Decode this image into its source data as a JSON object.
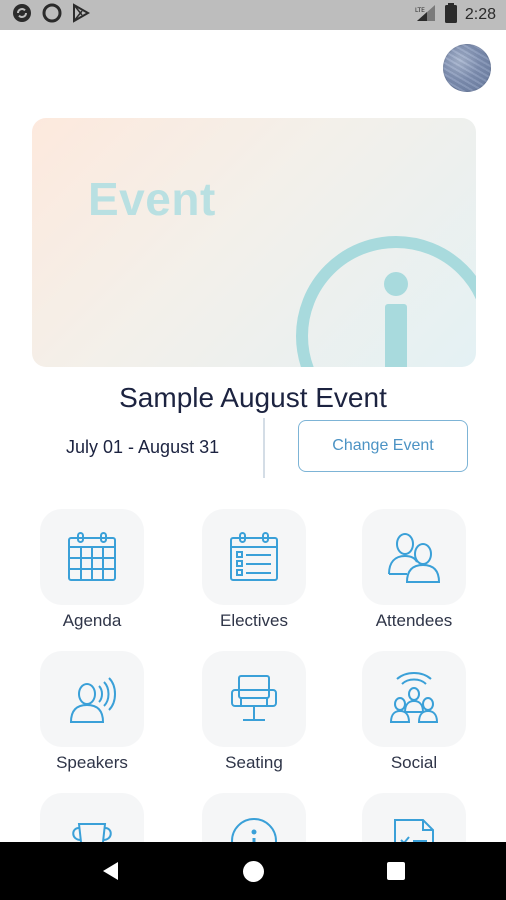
{
  "status_bar": {
    "time": "2:28",
    "icons": [
      "sync-icon",
      "circle-icon",
      "play-store-icon",
      "signal-lte-icon",
      "battery-icon"
    ]
  },
  "profile": {
    "avatar": "avatar"
  },
  "banner": {
    "word": "Event",
    "icon": "info-icon"
  },
  "event": {
    "title": "Sample August Event",
    "dates": "July 01 - August 31",
    "change_button": "Change Event"
  },
  "grid": {
    "items": [
      {
        "label": "Agenda",
        "icon": "calendar-icon"
      },
      {
        "label": "Electives",
        "icon": "checklist-calendar-icon"
      },
      {
        "label": "Attendees",
        "icon": "people-icon"
      },
      {
        "label": "Speakers",
        "icon": "speaker-icon"
      },
      {
        "label": "Seating",
        "icon": "chair-icon"
      },
      {
        "label": "Social",
        "icon": "social-broadcast-icon"
      },
      {
        "label": "",
        "icon": "trophy-icon"
      },
      {
        "label": "",
        "icon": "info-icon"
      },
      {
        "label": "",
        "icon": "survey-icon"
      }
    ]
  },
  "colors": {
    "icon_blue": "#3aa0d8",
    "title_navy": "#1c2340",
    "button_border": "#7db4d6",
    "banner_text": "#b9e0e2",
    "banner_icon": "#a8dadd"
  },
  "nav": {
    "back": "back-icon",
    "home": "home-icon",
    "recent": "recent-apps-icon"
  }
}
